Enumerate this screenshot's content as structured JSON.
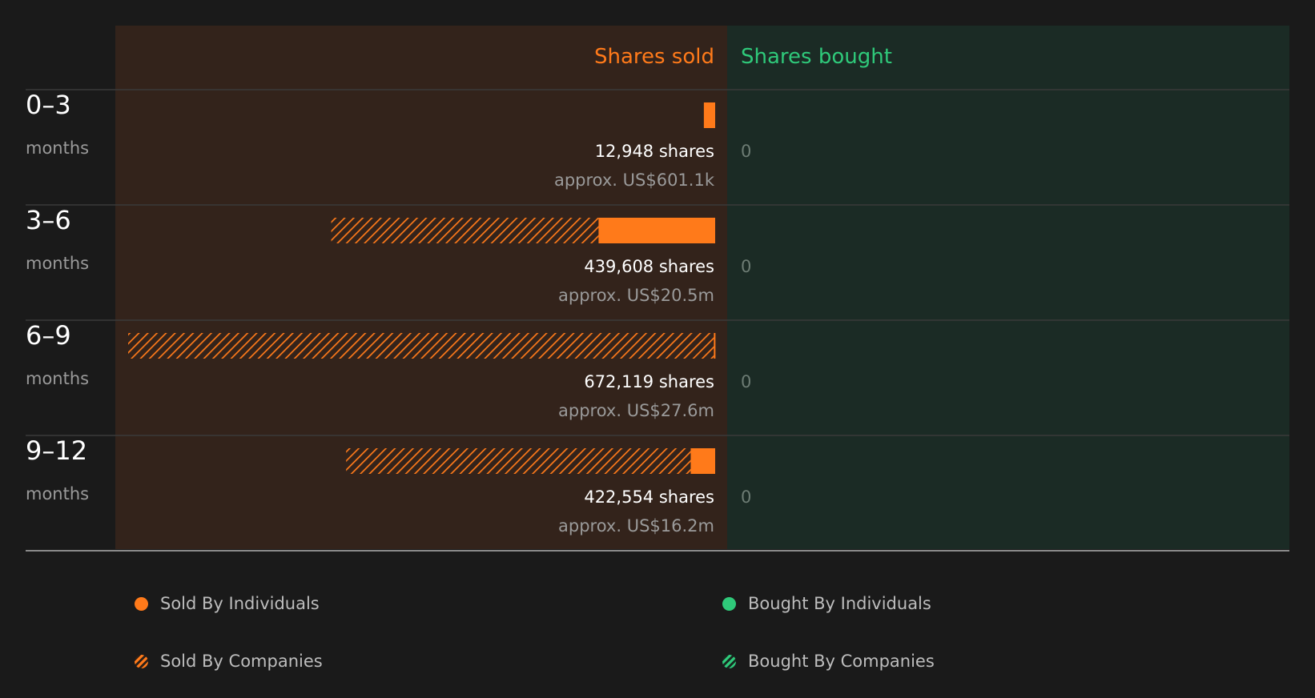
{
  "colors": {
    "background": "#1a1a1a",
    "sold": "#ff7a1a",
    "bought": "#2fc97a",
    "sold_panel": "#33231b",
    "bought_panel": "#1b2b25",
    "muted_text": "#9a9a9a"
  },
  "chart_data": {
    "type": "bar",
    "orientation": "horizontal-diverging",
    "headers": {
      "sold": "Shares sold",
      "bought": "Shares bought"
    },
    "categories": [
      {
        "range": "0–3",
        "unit": "months"
      },
      {
        "range": "3–6",
        "unit": "months"
      },
      {
        "range": "6–9",
        "unit": "months"
      },
      {
        "range": "9–12",
        "unit": "months"
      }
    ],
    "series": [
      {
        "name": "Sold By Individuals",
        "side": "sold",
        "pattern": "solid",
        "values": [
          12948,
          133500,
          1500,
          28000
        ]
      },
      {
        "name": "Sold By Companies",
        "side": "sold",
        "pattern": "hatched",
        "values": [
          0,
          306108,
          670619,
          394554
        ]
      },
      {
        "name": "Bought By Individuals",
        "side": "bought",
        "pattern": "solid",
        "values": [
          0,
          0,
          0,
          0
        ]
      },
      {
        "name": "Bought By Companies",
        "side": "bought",
        "pattern": "hatched",
        "values": [
          0,
          0,
          0,
          0
        ]
      }
    ],
    "sold_totals": [
      {
        "shares": "12,948 shares",
        "value": "approx. US$601.1k"
      },
      {
        "shares": "439,608 shares",
        "value": "approx. US$20.5m"
      },
      {
        "shares": "672,119 shares",
        "value": "approx. US$27.6m"
      },
      {
        "shares": "422,554 shares",
        "value": "approx. US$16.2m"
      }
    ],
    "bought_totals": [
      "0",
      "0",
      "0",
      "0"
    ],
    "max_value": 672119,
    "legend": [
      {
        "label": "Sold By Individuals",
        "color": "#ff7a1a",
        "pattern": "solid"
      },
      {
        "label": "Bought By Individuals",
        "color": "#2fc97a",
        "pattern": "solid"
      },
      {
        "label": "Sold By Companies",
        "color": "#ff7a1a",
        "pattern": "hatched"
      },
      {
        "label": "Bought By Companies",
        "color": "#2fc97a",
        "pattern": "hatched"
      }
    ],
    "legend_placement": "bottom"
  }
}
